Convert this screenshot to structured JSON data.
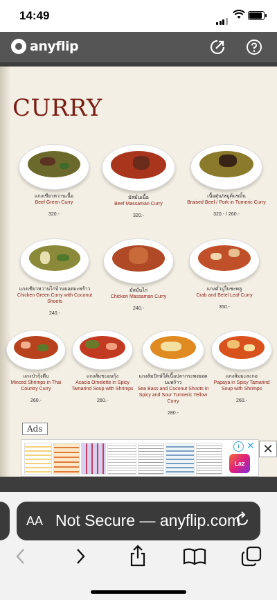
{
  "status_bar": {
    "time": "14:49"
  },
  "app_bar": {
    "logo_text": "anyflip"
  },
  "menu": {
    "title": "CURRY",
    "dishes": [
      {
        "thai": "แกงเขียวหวานเนื้อ",
        "english": "Beef Green Curry",
        "price": "320.-"
      },
      {
        "thai": "มัสมั่นเนื้อ",
        "english": "Beef Massaman Curry",
        "price": "320.-"
      },
      {
        "thai": "เนื้อตุ๋น/หมูต้มขมิ้น",
        "english": "Braised Beef / Pork in Tumeric Curry",
        "price": "320.- / 260.-"
      },
      {
        "thai": "แกงเขียวหวานไก่บ้านยอดมะพร้าว",
        "english": "Chicken Green Curry with Coconut Shoots",
        "price": "240.-"
      },
      {
        "thai": "มัสมั่นไก่",
        "english": "Chicken Massaman Curry",
        "price": "240.-"
      },
      {
        "thai": "แกงคั่วปูใบชะพลู",
        "english": "Crab and Betel Leaf Curry",
        "price": "350.-"
      },
      {
        "thai": "แกงป่ากุ้งดีบ",
        "english": "Minced Shrimps in Thai Country Curry",
        "price": "260.-"
      },
      {
        "thai": "แกงส้มชะอมกุ้ง",
        "english": "Acacia Omelette in Spicy Tamarind Soup with Shrimps",
        "price": "260.-"
      },
      {
        "thai": "แกงส้มปักษ์ใต้เนื้อปลากระพงยอดมะพร้าว",
        "english": "Sea Bass and Coconut Shoots in Spicy and Sour Turmeric Yellow Curry",
        "price": "280.-"
      },
      {
        "thai": "แกงส้มมะละกอ",
        "english": "Papaya in Spicy Tamarind Soup with Shrimps",
        "price": "260.-"
      }
    ]
  },
  "ads": {
    "label": "Ads",
    "info": "i",
    "close": "✕",
    "brand": "Laz",
    "dismiss": "✕"
  },
  "browser": {
    "text_size": "AA",
    "url": "Not Secure — anyflip.com"
  },
  "colors": {
    "title": "#7a1e14",
    "english": "#8a1a12",
    "page_bg": "#f4efe4",
    "app_bar": "#555555"
  },
  "icons": [
    "share-icon",
    "help-icon",
    "reload-icon",
    "back-icon",
    "forward-icon",
    "share-sheet-icon",
    "bookmarks-icon",
    "tabs-icon"
  ]
}
